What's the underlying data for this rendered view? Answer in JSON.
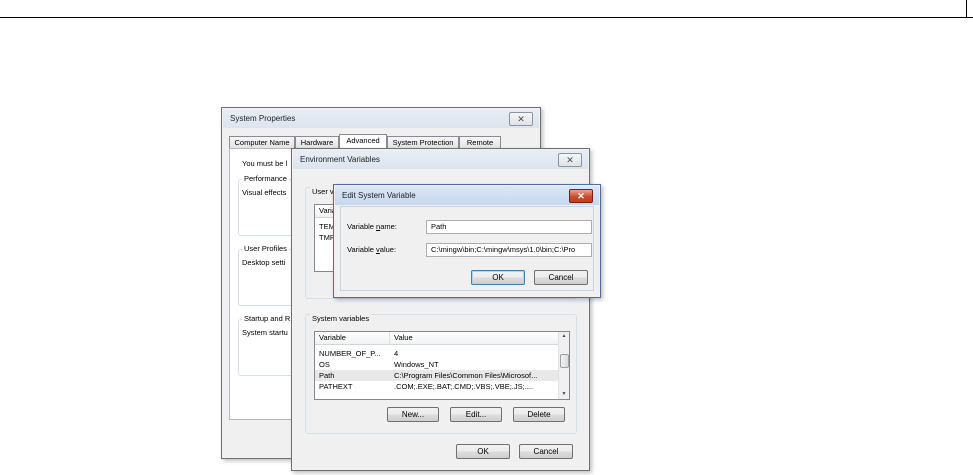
{
  "system_properties": {
    "title": "System Properties",
    "close_glyph": "✕",
    "tabs": [
      "Computer Name",
      "Hardware",
      "Advanced",
      "System Protection",
      "Remote"
    ],
    "selected_tab": "Advanced",
    "intro_text": "You must be l",
    "groups": [
      {
        "label": "Performance",
        "text": "Visual effects"
      },
      {
        "label": "User Profiles",
        "text": "Desktop setti"
      },
      {
        "label": "Startup and R",
        "text": "System startu"
      }
    ]
  },
  "environment_variables": {
    "title": "Environment Variables",
    "close_glyph": "✕",
    "user_group_label": "User v",
    "user_list": {
      "header": "Varia",
      "rows": [
        "TEM",
        "TMP"
      ]
    },
    "system_group_label": "System variables",
    "system_list": {
      "columns": [
        "Variable",
        "Value"
      ],
      "rows": [
        {
          "variable": "NUMBER_OF_P...",
          "value": "4"
        },
        {
          "variable": "OS",
          "value": "Windows_NT"
        },
        {
          "variable": "Path",
          "value": "C:\\Program Files\\Common Files\\Microsof..."
        },
        {
          "variable": "PATHEXT",
          "value": ".COM;.EXE;.BAT;.CMD;.VBS;.VBE;.JS;...."
        }
      ],
      "selected_row": "Path"
    },
    "buttons": {
      "new": "New...",
      "edit": "Edit...",
      "delete": "Delete"
    },
    "ok": "OK",
    "cancel": "Cancel"
  },
  "edit_system_variable": {
    "title": "Edit System Variable",
    "close_glyph": "✕",
    "name_label_pre": "Variable ",
    "name_label_ul": "n",
    "name_label_post": "ame:",
    "name_value": "Path",
    "value_label_pre": "Variable ",
    "value_label_ul": "v",
    "value_label_post": "alue:",
    "value_value": "C:\\mingw\\bin;C:\\mingw\\msys\\1.0\\bin;C:\\Pro",
    "ok": "OK",
    "cancel": "Cancel"
  }
}
